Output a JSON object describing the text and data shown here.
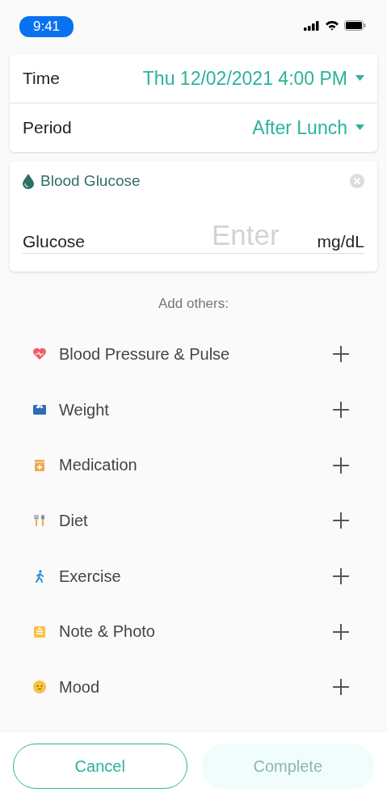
{
  "status_bar": {
    "time": "9:41"
  },
  "settings": [
    {
      "label": "Time",
      "value": "Thu 12/02/2021 4:00 PM"
    },
    {
      "label": "Period",
      "value": "After Lunch"
    }
  ],
  "measurement": {
    "title": "Blood Glucose",
    "field_label": "Glucose",
    "placeholder": "Enter",
    "unit": "mg/dL"
  },
  "add_others": {
    "heading": "Add others:",
    "items": [
      {
        "kind": "heart",
        "label": "Blood Pressure & Pulse"
      },
      {
        "kind": "scale",
        "label": "Weight"
      },
      {
        "kind": "pill",
        "label": "Medication"
      },
      {
        "kind": "diet",
        "label": "Diet"
      },
      {
        "kind": "walk",
        "label": "Exercise"
      },
      {
        "kind": "note",
        "label": "Note & Photo"
      },
      {
        "kind": "mood",
        "label": "Mood"
      }
    ]
  },
  "buttons": [
    {
      "label": "Cancel",
      "disabled": false
    },
    {
      "label": "Complete",
      "disabled": true
    }
  ]
}
